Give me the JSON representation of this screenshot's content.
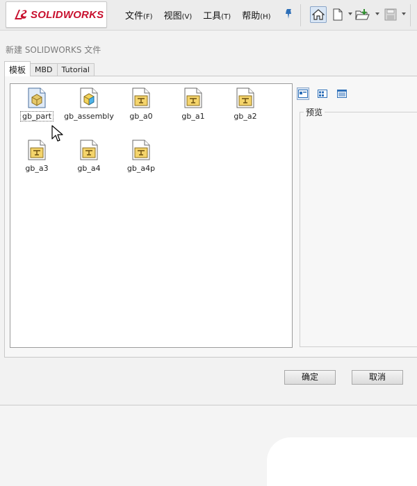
{
  "app": {
    "logo_text": "SOLIDWORKS",
    "brand_color": "#c8102e",
    "menu": [
      {
        "label": "文件",
        "accel": "(F)"
      },
      {
        "label": "视图",
        "accel": "(V)"
      },
      {
        "label": "工具",
        "accel": "(T)"
      },
      {
        "label": "帮助",
        "accel": "(H)"
      }
    ],
    "toolbar_icons": [
      "pin-icon",
      "home-icon",
      "new-document-icon",
      "open-folder-icon",
      "save-icon"
    ]
  },
  "dialog": {
    "title": "新建 SOLIDWORKS 文件",
    "tabs": [
      {
        "label": "模板",
        "active": true
      },
      {
        "label": "MBD",
        "active": false
      },
      {
        "label": "Tutorial",
        "active": false
      }
    ],
    "templates": [
      {
        "label": "gb_part",
        "kind": "part",
        "selected": true
      },
      {
        "label": "gb_assembly",
        "kind": "assembly",
        "selected": false
      },
      {
        "label": "gb_a0",
        "kind": "drawing",
        "selected": false
      },
      {
        "label": "gb_a1",
        "kind": "drawing",
        "selected": false
      },
      {
        "label": "gb_a2",
        "kind": "drawing",
        "selected": false
      },
      {
        "label": "gb_a3",
        "kind": "drawing",
        "selected": false
      },
      {
        "label": "gb_a4",
        "kind": "drawing",
        "selected": false
      },
      {
        "label": "gb_a4p",
        "kind": "drawing",
        "selected": false
      }
    ],
    "view_modes": [
      "large-icons-view-icon",
      "list-view-icon",
      "details-view-icon"
    ],
    "preview_label": "预览",
    "ok_label": "确定",
    "cancel_label": "取消"
  }
}
